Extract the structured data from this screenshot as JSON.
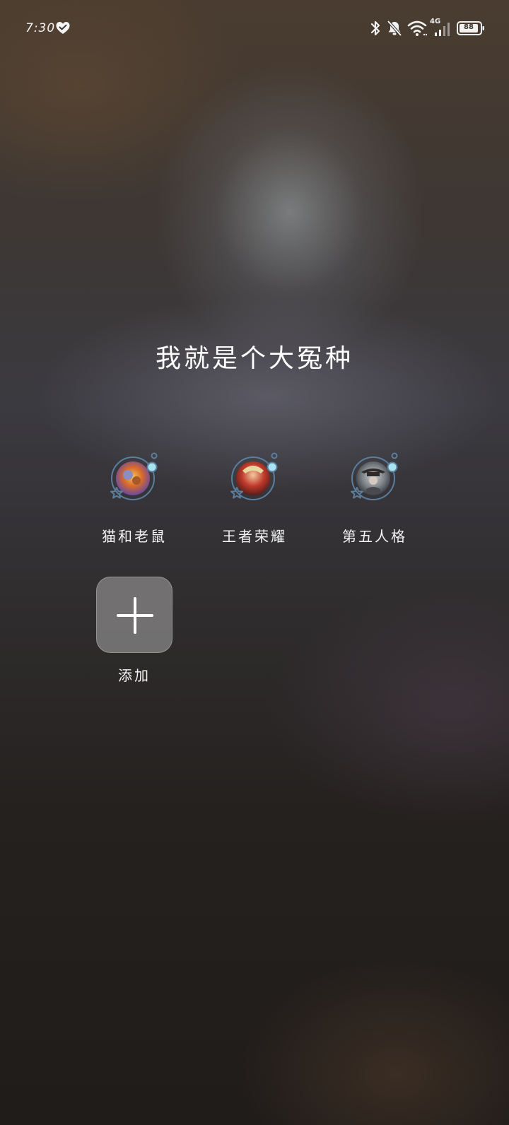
{
  "status_bar": {
    "time": "7:30",
    "network_label": "4G",
    "battery_level": "88",
    "icons": [
      "heart-icon",
      "bluetooth-icon",
      "mute-bell-icon",
      "wifi-icon",
      "cellular-signal-icon",
      "battery-icon"
    ]
  },
  "title": "我就是个大冤种",
  "games": [
    {
      "label": "猫和老鼠",
      "icon": "tom-and-jerry-avatar-icon"
    },
    {
      "label": "王者荣耀",
      "icon": "honor-of-kings-avatar-icon"
    },
    {
      "label": "第五人格",
      "icon": "identity-v-avatar-icon"
    }
  ],
  "add": {
    "label": "添加",
    "icon": "plus-icon"
  },
  "colors": {
    "ring": "#5b7e9e",
    "ring_dot": "#a9e3f0",
    "add_tile": "#8c8a8a"
  }
}
